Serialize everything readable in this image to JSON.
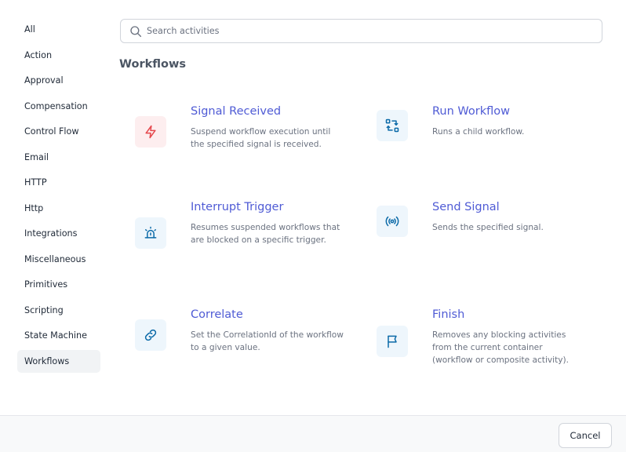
{
  "sidebar": {
    "items": [
      {
        "label": "All"
      },
      {
        "label": "Action"
      },
      {
        "label": "Approval"
      },
      {
        "label": "Compensation"
      },
      {
        "label": "Control Flow"
      },
      {
        "label": "Email"
      },
      {
        "label": "HTTP"
      },
      {
        "label": "Http"
      },
      {
        "label": "Integrations"
      },
      {
        "label": "Miscellaneous"
      },
      {
        "label": "Primitives"
      },
      {
        "label": "Scripting"
      },
      {
        "label": "State Machine"
      },
      {
        "label": "Workflows",
        "active": true
      }
    ]
  },
  "search": {
    "placeholder": "Search activities",
    "value": "",
    "icon": "search-icon"
  },
  "section": {
    "title": "Workflows"
  },
  "activities": [
    {
      "title": "Signal Received",
      "description": "Suspend workflow execution until the specified signal is received.",
      "icon": "bolt-icon",
      "accent": "#e5484d"
    },
    {
      "title": "Run Workflow",
      "description": "Runs a child workflow.",
      "icon": "swap-icon",
      "accent": "#0b6aa8"
    },
    {
      "title": "Interrupt Trigger",
      "description": "Resumes suspended workflows that are blocked on a specific trigger.",
      "icon": "alarm-icon",
      "accent": "#0b6aa8"
    },
    {
      "title": "Send Signal",
      "description": "Sends the specified signal.",
      "icon": "broadcast-icon",
      "accent": "#0b6aa8"
    },
    {
      "title": "Correlate",
      "description": "Set the CorrelationId of the workflow to a given value.",
      "icon": "link-icon",
      "accent": "#0b6aa8"
    },
    {
      "title": "Finish",
      "description": "Removes any blocking activities from the current container (workflow or composite activity).",
      "icon": "flag-icon",
      "accent": "#0b6aa8"
    }
  ],
  "footer": {
    "cancel_label": "Cancel"
  }
}
